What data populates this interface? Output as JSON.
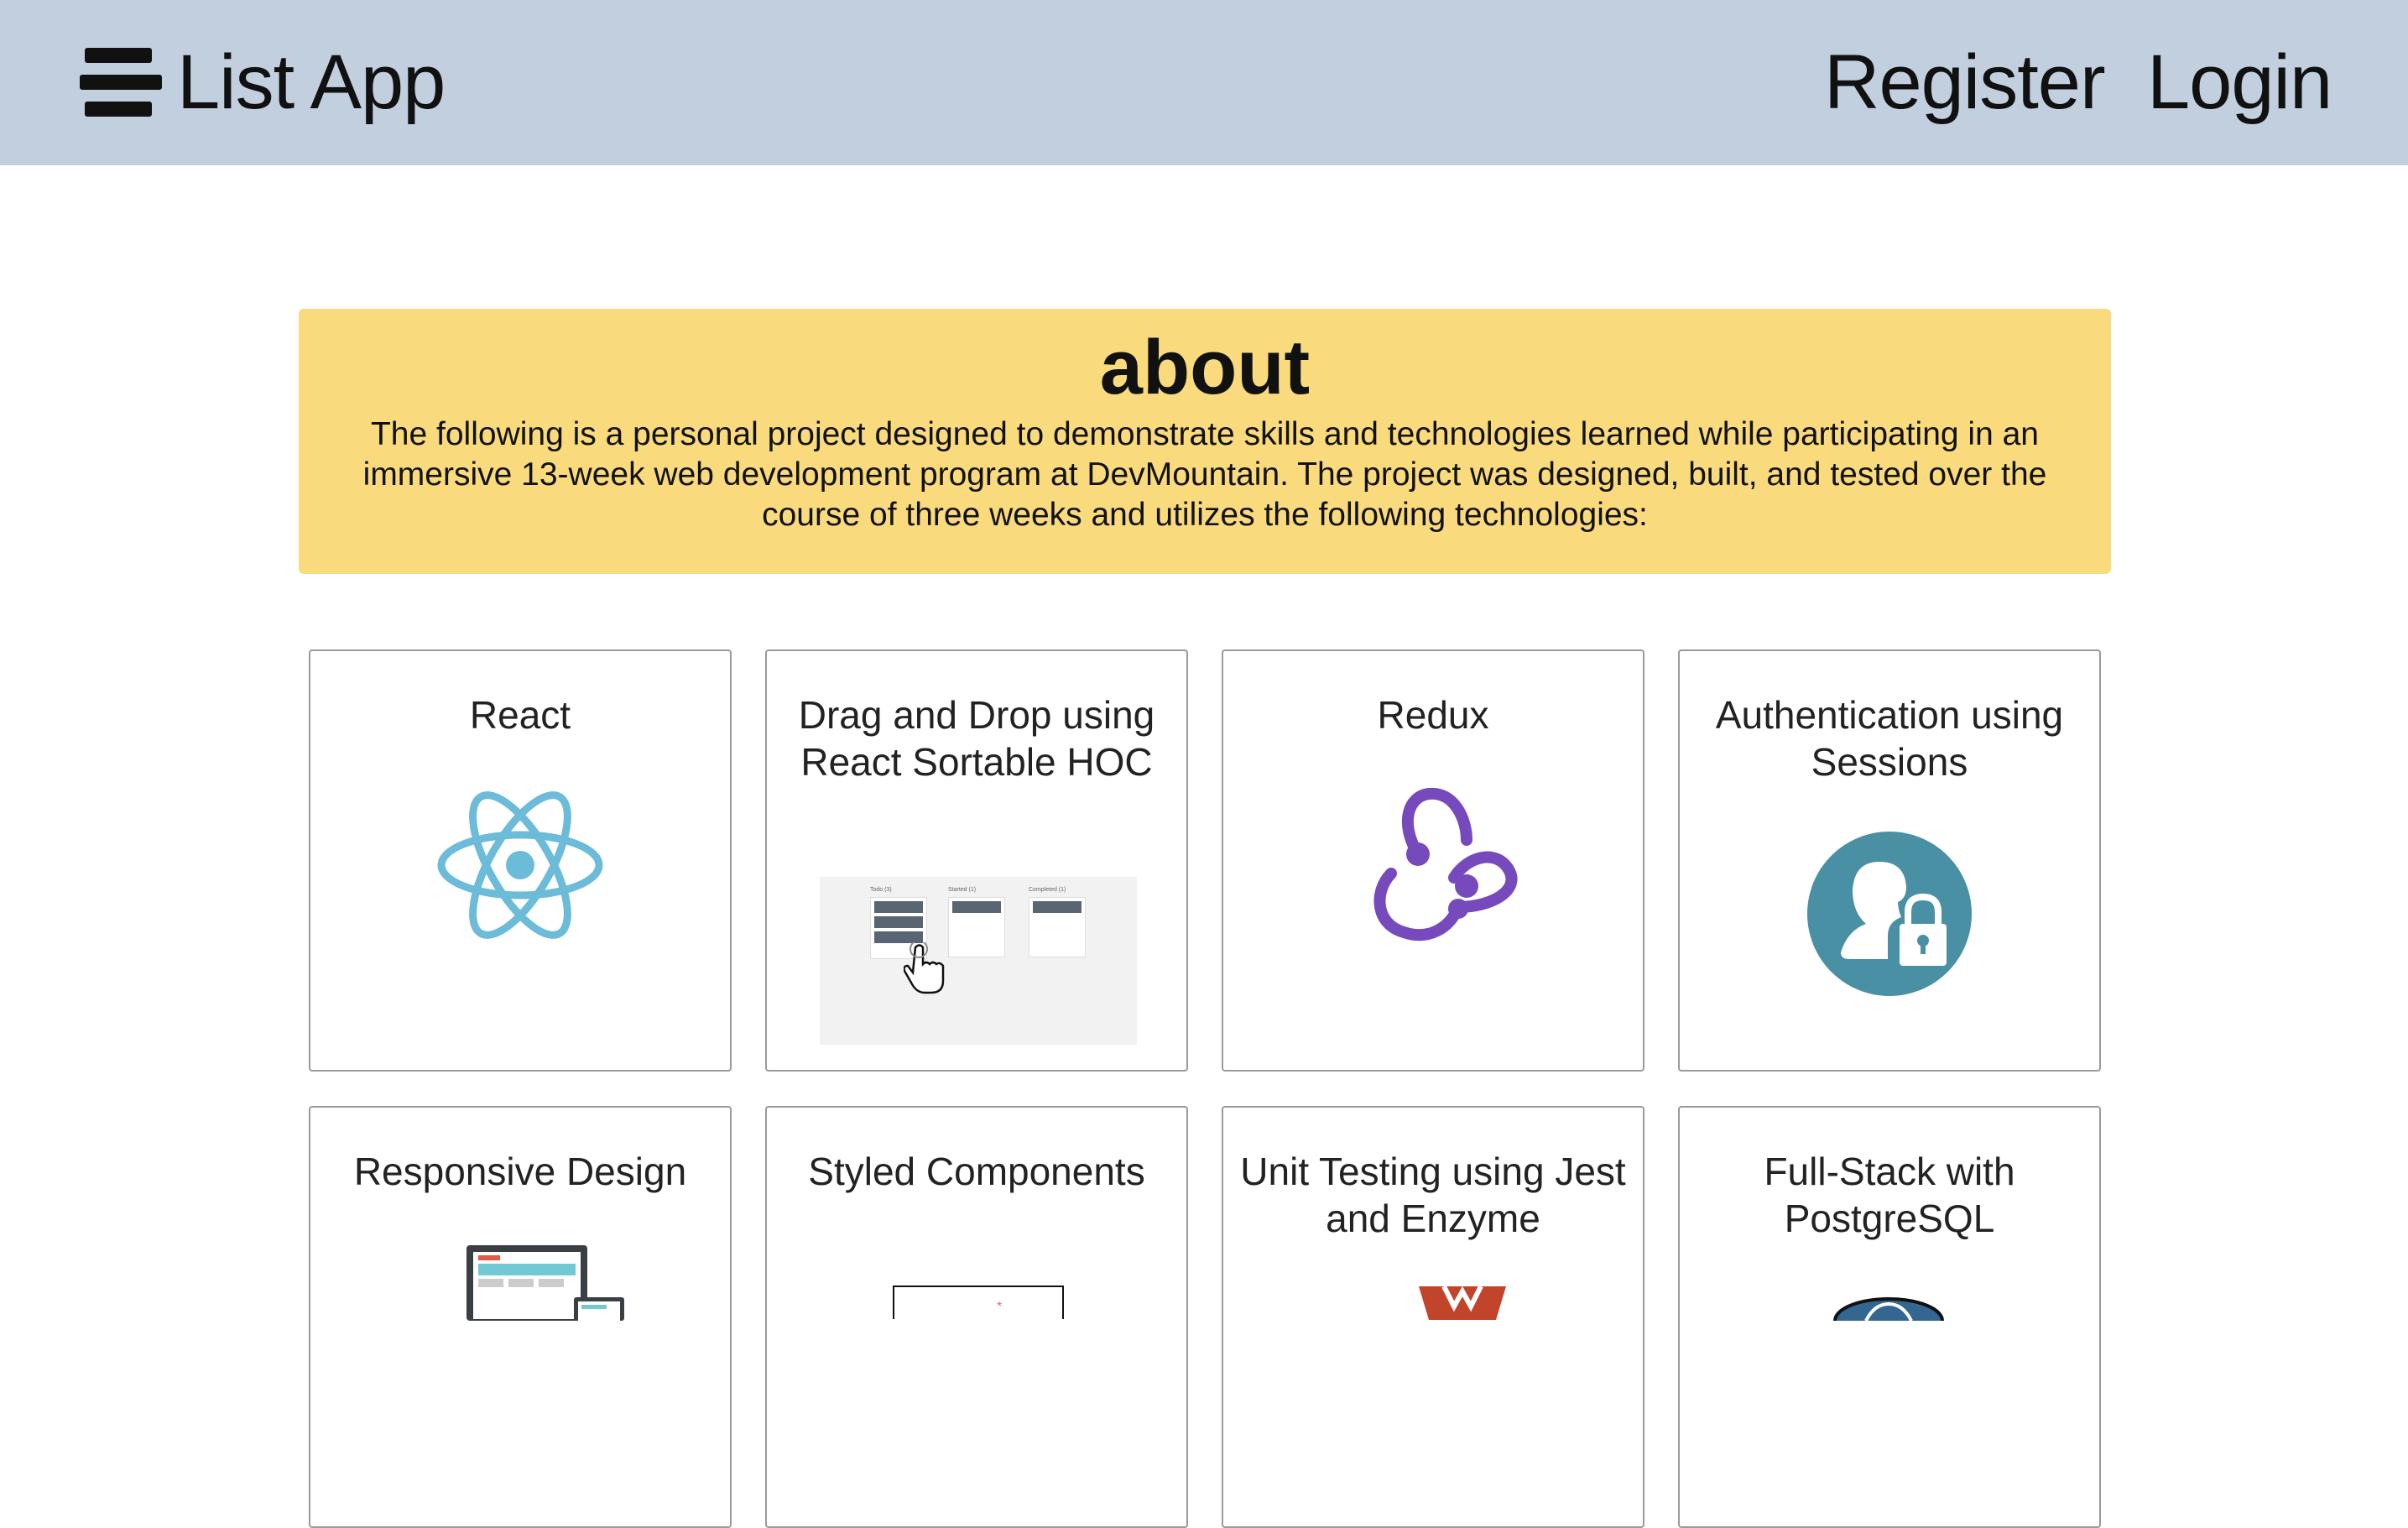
{
  "header": {
    "app_title": "List App",
    "nav": {
      "register": "Register",
      "login": "Login"
    },
    "background": "#c2cfdf"
  },
  "about": {
    "title": "about",
    "text": "The following is a personal project designed to demonstrate skills and technologies learned while participating in an immersive 13-week web development program at DevMountain. The project was designed, built, and tested over the course of three weeks and utilizes the following technologies:",
    "background": "#f9db7e"
  },
  "cards": [
    {
      "title": "React",
      "icon": "react-logo-icon"
    },
    {
      "title": "Drag and Drop using React Sortable HOC",
      "icon": "drag-drop-preview-image"
    },
    {
      "title": "Redux",
      "icon": "redux-logo-icon"
    },
    {
      "title": "Authentication using Sessions",
      "icon": "user-lock-icon"
    },
    {
      "title": "Responsive Design",
      "icon": "responsive-devices-icon"
    },
    {
      "title": "Styled Components",
      "icon": "styled-components-icon"
    },
    {
      "title": "Unit Testing using Jest and Enzyme",
      "icon": "enzyme-logo-icon"
    },
    {
      "title": "Full-Stack with PostgreSQL",
      "icon": "postgresql-logo-icon"
    }
  ],
  "drag_preview": {
    "columns": [
      "Todo (3)",
      "Started (1)",
      "Completed (1)"
    ]
  },
  "colors": {
    "react": "#6cbcd9",
    "redux": "#764abc",
    "auth": "#4a90a4",
    "enzyme": "#c2442a",
    "postgres": "#336791"
  }
}
